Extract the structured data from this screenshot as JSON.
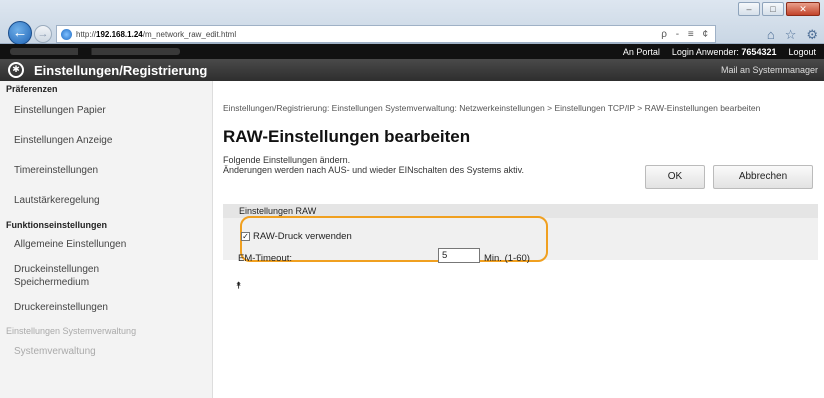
{
  "browser": {
    "address": {
      "prefix": "http://",
      "host": "192.168.1.24",
      "path": "/m_network_raw_edit.html"
    },
    "address_tools": "ρ - ≡ ¢",
    "window_buttons": [
      "‒",
      "□",
      "✕"
    ]
  },
  "topbar": {
    "portal": "An Portal",
    "login_label": "Login Anwender:",
    "login_id": "7654321",
    "logout": "Logout"
  },
  "header": {
    "title": "Einstellungen/Registrierung",
    "mail_link": "Mail an Systemmanager"
  },
  "sidebar": {
    "heading1": "Präferenzen",
    "items1": [
      "Einstellungen Papier",
      "Einstellungen Anzeige",
      "Timereinstellungen",
      "Lautstärkeregelung"
    ],
    "heading2": "Funktionseinstellungen",
    "items2": [
      "Allgemeine Einstellungen",
      "Druckeinstellungen Speichermedium",
      "Druckereinstellungen"
    ],
    "heading3": "Einstellungen Systemverwaltung",
    "items3": [
      "Systemverwaltung"
    ]
  },
  "main": {
    "breadcrumb": "Einstellungen/Registrierung: Einstellungen Systemverwaltung: Netzwerkeinstellungen > Einstellungen TCP/IP > RAW-Einstellungen bearbeiten",
    "title": "RAW-Einstellungen bearbeiten",
    "desc1": "Folgende Einstellungen ändern.",
    "desc2": "Änderungen werden nach AUS- und wieder EINschalten des Systems aktiv.",
    "ok_label": "OK",
    "cancel_label": "Abbrechen",
    "section_title": "Einstellungen RAW",
    "checkbox_label": "RAW-Druck verwenden",
    "checkbox_checked": true,
    "timeout_label": "EM-Timeout:",
    "timeout_value": "5",
    "timeout_unit": "Min. (1-60)",
    "top_arrow": "⯭"
  },
  "colors": {
    "highlight": "#f0a020",
    "header_bg": "#3a3a3a",
    "topbar_bg": "#111111"
  }
}
